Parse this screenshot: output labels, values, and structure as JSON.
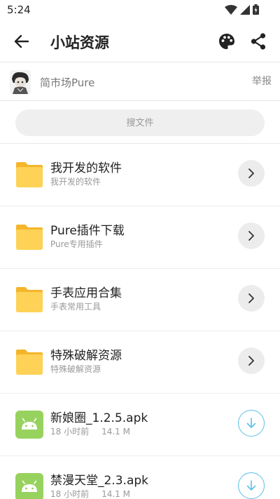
{
  "status_bar": {
    "time": "5:24"
  },
  "app_bar": {
    "title": "小站资源"
  },
  "owner": {
    "name": "简市场Pure",
    "report_label": "举报"
  },
  "search": {
    "placeholder": "搜文件"
  },
  "folders": [
    {
      "title": "我开发的软件",
      "subtitle": "我开发的软件"
    },
    {
      "title": "Pure插件下载",
      "subtitle": "Pure专用插件"
    },
    {
      "title": "手表应用合集",
      "subtitle": "手表常用工具"
    },
    {
      "title": "特殊破解资源",
      "subtitle": "特殊破解资源"
    }
  ],
  "files": [
    {
      "name": "新娘圈_1.2.5.apk",
      "time": "18 小时前",
      "size": "14.1 M"
    },
    {
      "name": "禁漫天堂_2.3.apk",
      "time": "18 小时前",
      "size": "14.1 M"
    }
  ],
  "colors": {
    "folder": "#fdd256",
    "folder_tab": "#f5b52a",
    "apk_icon": "#97d25f",
    "download_accent": "#5bc0e8"
  }
}
